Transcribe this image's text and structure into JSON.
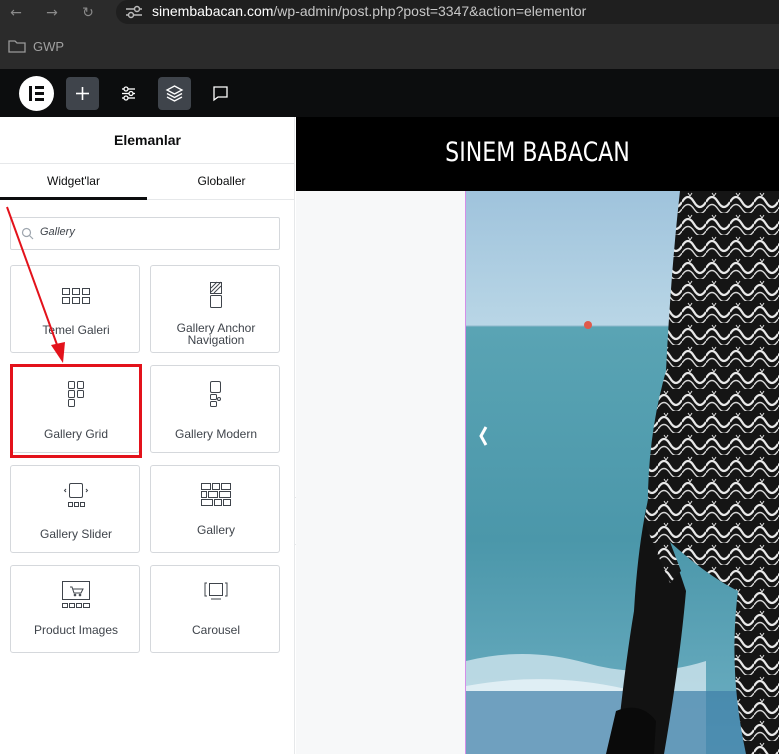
{
  "browser": {
    "url_host": "sinembabacan.com",
    "url_path": "/wp-admin/post.php?post=3347&action=elementor",
    "bookmark_folder": "GWP"
  },
  "toolbar": {
    "icons": [
      "elementor-logo-icon",
      "plus-icon",
      "sliders-icon",
      "layers-icon",
      "comment-icon"
    ]
  },
  "panel": {
    "title": "Elemanlar",
    "tabs": [
      {
        "label": "Widget'lar",
        "active": true
      },
      {
        "label": "Globaller",
        "active": false
      }
    ],
    "search": {
      "value": "Gallery"
    },
    "widgets": [
      {
        "label": "Temel Galeri"
      },
      {
        "label": "Gallery Anchor Navigation"
      },
      {
        "label": "Gallery Grid",
        "highlighted": true
      },
      {
        "label": "Gallery Modern"
      },
      {
        "label": "Gallery Slider"
      },
      {
        "label": "Gallery"
      },
      {
        "label": "Product Images"
      },
      {
        "label": "Carousel"
      }
    ]
  },
  "preview": {
    "site_title": "SINEM BABACAN"
  },
  "colors": {
    "annotation": "#e3121b",
    "topbar": "#0c0d0e",
    "accent_border": "#d58ee8"
  }
}
